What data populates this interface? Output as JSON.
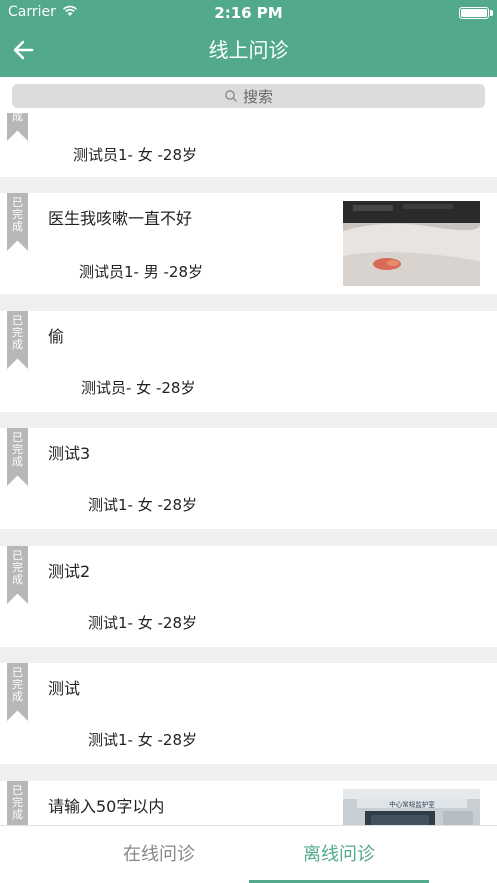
{
  "status_bar": {
    "carrier": "Carrier",
    "time": "2:16 PM"
  },
  "nav": {
    "title": "线上问诊"
  },
  "search": {
    "placeholder": "搜索"
  },
  "badge_text": "已完成",
  "items": [
    {
      "title": "",
      "patient": "测试员1- 女 -28岁"
    },
    {
      "title": "医生我咳嗽一直不好",
      "patient": "测试员1- 男 -28岁",
      "has_image": true
    },
    {
      "title": "偷",
      "patient": "测试员- 女 -28岁"
    },
    {
      "title": "测试3",
      "patient": "测试1- 女 -28岁"
    },
    {
      "title": "测试2",
      "patient": "测试1- 女 -28岁"
    },
    {
      "title": "测试",
      "patient": "测试1- 女 -28岁"
    },
    {
      "title": "请输入50字以内",
      "patient": "",
      "has_image": true,
      "image_caption": "中心常规监护室"
    }
  ],
  "tabs": {
    "online": "在线问诊",
    "offline": "离线问诊",
    "active": "offline"
  },
  "colors": {
    "primary": "#52a98b",
    "badge": "#b7b7b7"
  }
}
